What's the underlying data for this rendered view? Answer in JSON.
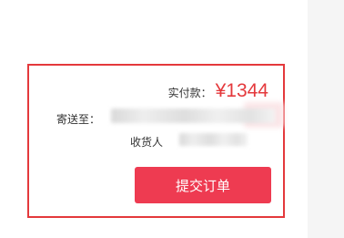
{
  "order": {
    "total_label": "实付款：",
    "total_amount": "¥1344",
    "ship_label": "寄送至：",
    "receiver_label": "收货人",
    "submit_label": "提交订单"
  },
  "colors": {
    "accent": "#e4393c",
    "button": "#ee3b51"
  }
}
